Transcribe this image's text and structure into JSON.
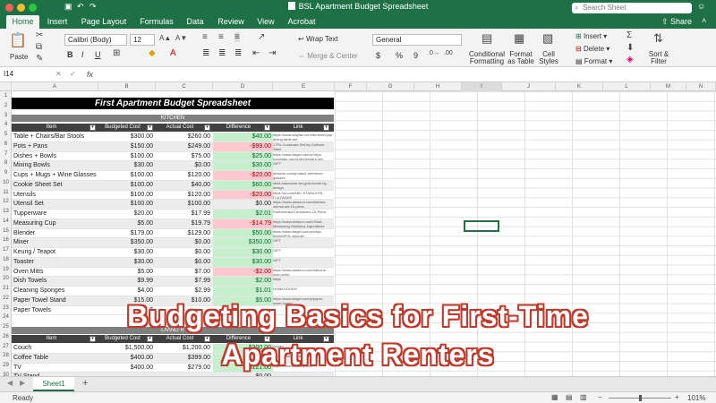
{
  "window": {
    "title": "BSL Apartment Budget Spreadsheet",
    "search_placeholder": "Search Sheet",
    "share_label": "Share"
  },
  "ribbon_tabs": [
    "Home",
    "Insert",
    "Page Layout",
    "Formulas",
    "Data",
    "Review",
    "View",
    "Acrobat"
  ],
  "ribbon": {
    "paste": "Paste",
    "font_name": "Calibri (Body)",
    "font_size": "12",
    "bold": "B",
    "italic": "I",
    "underline": "U",
    "wrap_text": "Wrap Text",
    "merge_center": "Merge & Center",
    "number_format": "General",
    "currency": "$",
    "percent": "%",
    "comma": "9",
    "conditional_formatting": [
      "Conditional",
      "Formatting"
    ],
    "format_as_table": [
      "Format",
      "as Table"
    ],
    "cell_styles": [
      "Cell",
      "Styles"
    ],
    "insert": "Insert",
    "delete": "Delete",
    "format": "Format",
    "sort_filter": [
      "Sort &",
      "Filter"
    ]
  },
  "formula_bar": {
    "name_box": "I14",
    "fx": "fx",
    "value": ""
  },
  "columns": [
    "A",
    "B",
    "C",
    "D",
    "E",
    "F",
    "G",
    "H",
    "I",
    "J",
    "K",
    "L",
    "M",
    "N"
  ],
  "rows": [
    "1",
    "2",
    "3",
    "4",
    "5",
    "6",
    "7",
    "8",
    "9",
    "10",
    "11",
    "12",
    "13",
    "14",
    "15",
    "16",
    "17",
    "18",
    "19",
    "20",
    "21",
    "22",
    "23",
    "24",
    "25",
    "26",
    "27",
    "28",
    "29",
    "30"
  ],
  "spreadsheet": {
    "title": "First Apartment Budget Spreadsheet",
    "kitchen_section": "KITCHEN",
    "living_section": "LIVING R",
    "headers": [
      "Item",
      "Budgeted Cost",
      "Actual Cost",
      "Difference",
      "Link"
    ],
    "kitchen_items": [
      {
        "item": "Table + Chairs/Bar Stools",
        "budget": "$300.00",
        "actual": "$260.00",
        "diff": "$40.00",
        "link": "https://www.wayfair.com/furniture/pdp/a-dining-table-set",
        "status": "pos"
      },
      {
        "item": "Pots + Pans",
        "budget": "$150.00",
        "actual": "$249.00",
        "diff": "-$99.00",
        "link": "17Pc-Cookware-Set-by-Gotham-Steel",
        "status": "neg"
      },
      {
        "item": "Dishes + Bowls",
        "budget": "$100.00",
        "actual": "$75.00",
        "diff": "$25.00",
        "link": "https://www.target.com/p/16pc-porcelain-round-dinnerware-set-white",
        "status": "pos"
      },
      {
        "item": "Mixing Bowls",
        "budget": "$30.00",
        "actual": "$0.00",
        "diff": "$30.00",
        "link": "GIFT",
        "status": "pos"
      },
      {
        "item": "Cups + Mugs + Wine Glasses",
        "budget": "$100.00",
        "actual": "$120.00",
        "diff": "-$20.00",
        "link": "amazon.com/product-reference-glasses",
        "status": "neg"
      },
      {
        "item": "Cookie Sheet Set",
        "budget": "$100.00",
        "actual": "$40.00",
        "diff": "$60.00",
        "link": "steel-bakeware-set-gold-made-by-design",
        "status": "pos"
      },
      {
        "item": "Utensils",
        "budget": "$100.00",
        "actual": "$120.00",
        "diff": "-$20.00",
        "link": "https://a.co/d/ABC-STAINLESS-FLATWARE",
        "status": "neg"
      },
      {
        "item": "Utensil Set",
        "budget": "$100.00",
        "actual": "$100.00",
        "diff": "$0.00",
        "link": "https://www.amazon.com/kitchen-utensil-set-15-piece",
        "status": "zero"
      },
      {
        "item": "Tupperware",
        "budget": "$20.00",
        "actual": "$17.99",
        "diff": "$2.01",
        "link": "Rubbermaid-Containers-10-Piece",
        "status": "pos"
      },
      {
        "item": "Measuring Cup",
        "budget": "$5.00",
        "actual": "$19.79",
        "diff": "-$14.79",
        "link": "https://www.amazon.com/Glad-Measuring-Stainless-Ingredients",
        "status": "neg"
      },
      {
        "item": "Blender",
        "budget": "$179.00",
        "actual": "$129.00",
        "diff": "$50.00",
        "link": "https://www.target.com/p/ninja-B00M9PHL-blender",
        "status": "pos"
      },
      {
        "item": "Mixer",
        "budget": "$350.00",
        "actual": "$0.00",
        "diff": "$350.00",
        "link": "GIFT",
        "status": "pos"
      },
      {
        "item": "Keurig / Teapot",
        "budget": "$30.00",
        "actual": "$0.00",
        "diff": "$30.00",
        "link": "GIFT",
        "status": "pos"
      },
      {
        "item": "Toaster",
        "budget": "$30.00",
        "actual": "$0.00",
        "diff": "$30.00",
        "link": "GIFT",
        "status": "pos"
      },
      {
        "item": "Oven Mitts",
        "budget": "$5.00",
        "actual": "$7.00",
        "diff": "-$2.00",
        "link": "https://www.amazon.com/silicone-oven-mitts",
        "status": "neg"
      },
      {
        "item": "Dish Towels",
        "budget": "$9.99",
        "actual": "$7.99",
        "diff": "$2.00",
        "link": "https",
        "status": "pos"
      },
      {
        "item": "Cleaning Sponges",
        "budget": "$4.00",
        "actual": "$2.99",
        "diff": "$1.01",
        "link": "HOMEGOODS",
        "status": "pos"
      },
      {
        "item": "Paper Towel Stand",
        "budget": "$15.00",
        "actual": "$10.00",
        "diff": "$5.00",
        "link": "https://www.target.com/p/paper-towel-holder",
        "status": "pos"
      },
      {
        "item": "Paper Towels",
        "budget": "$",
        "actual": "",
        "diff": "",
        "link": "",
        "status": "zero"
      }
    ],
    "living_items": [
      {
        "item": "Couch",
        "budget": "$1,500.00",
        "actual": "$1,200.00",
        "diff": "$300.00",
        "link": "Ashley",
        "status": "pos"
      },
      {
        "item": "Coffee Table",
        "budget": "$400.00",
        "actual": "$399.00",
        "diff": "$1.00",
        "link": "https://www.wayfair.com",
        "status": "pos"
      },
      {
        "item": "TV",
        "budget": "$400.00",
        "actual": "$279.00",
        "diff": "$121.00",
        "link": "https://www.bestbuy.com",
        "status": "pos"
      },
      {
        "item": "TV Stand",
        "budget": "",
        "actual": "",
        "diff": "$0.00",
        "link": "",
        "status": "zero"
      }
    ]
  },
  "overlay": {
    "line1": "Budgeting Basics for First-Time",
    "line2": "Apartment Renters"
  },
  "sheet_tab": "Sheet1",
  "add_sheet": "+",
  "status": {
    "ready": "Ready",
    "zoom": "101%"
  },
  "colors": {
    "excel_green": "#1e7145",
    "overlay_outline": "#c0392b",
    "positive_fill": "#c6efce",
    "negative_fill": "#ffc7ce"
  }
}
